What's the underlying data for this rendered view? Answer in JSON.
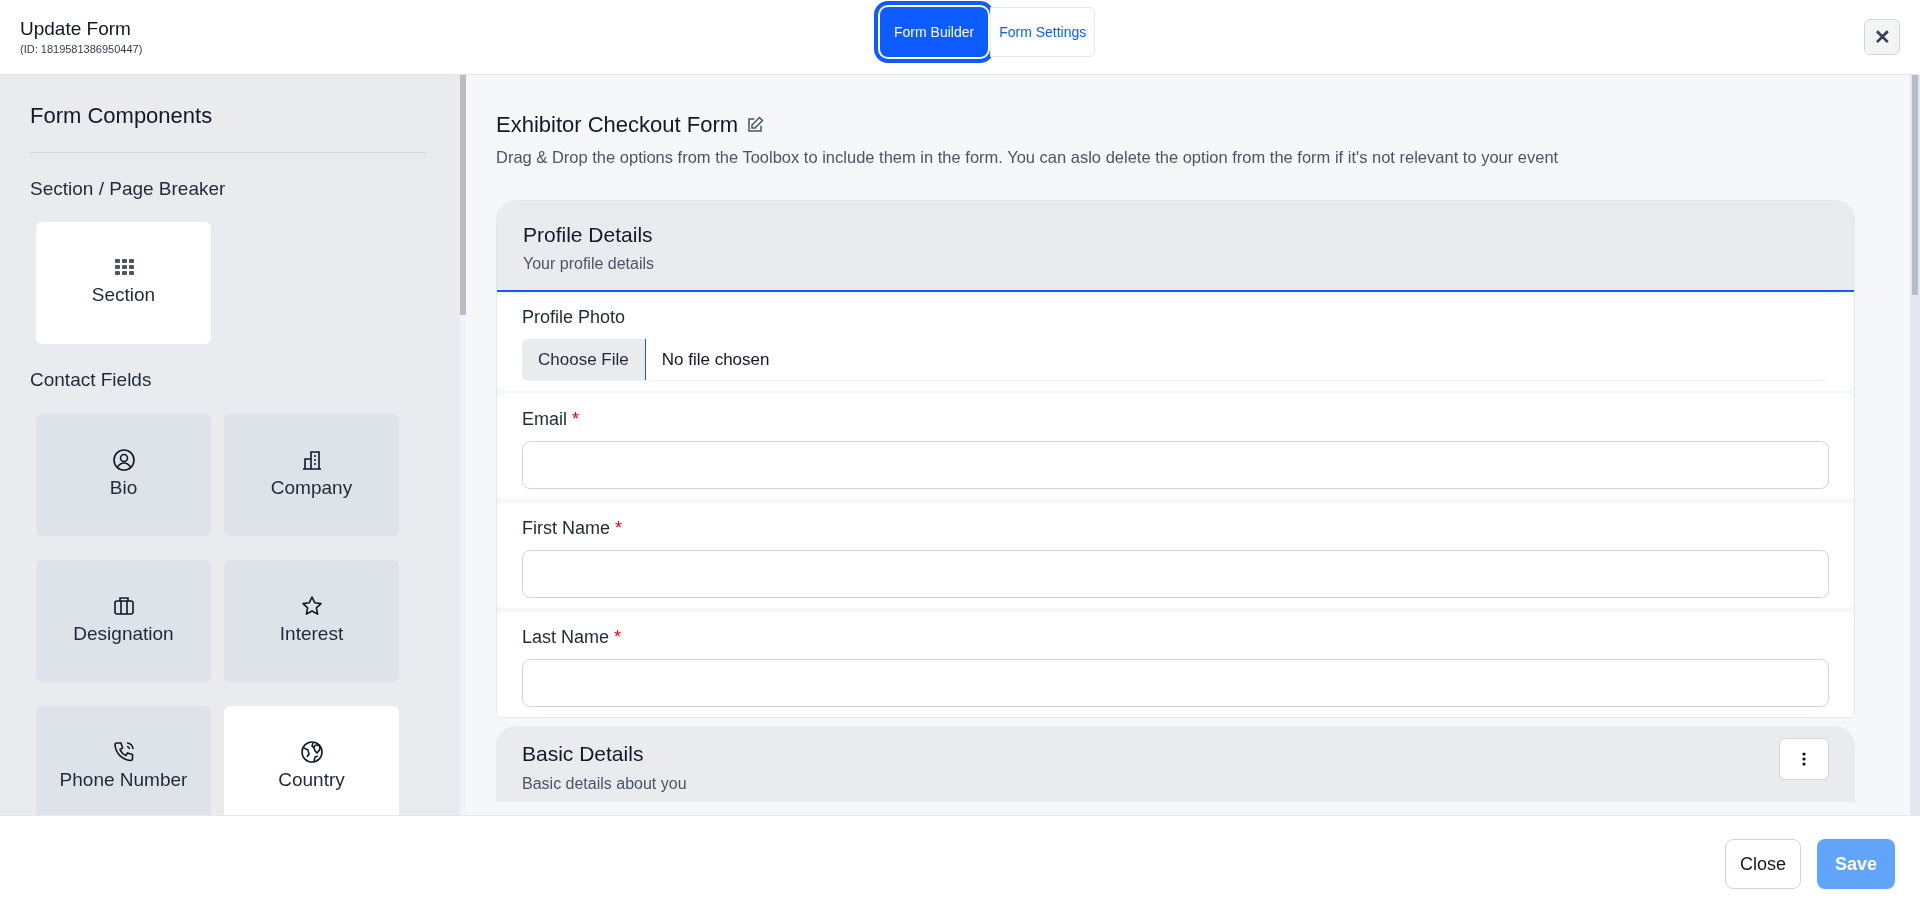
{
  "header": {
    "title": "Update Form",
    "subtitle": "(ID: 1819581386950447)",
    "tabs": [
      {
        "label": "Form Builder",
        "selected": true
      },
      {
        "label": "Form Settings",
        "selected": false
      }
    ],
    "close_icon": "✕"
  },
  "sidebar": {
    "title": "Form Components",
    "groups": [
      {
        "label": "Section / Page Breaker",
        "items": [
          {
            "label": "Section",
            "highlighted": true
          }
        ]
      },
      {
        "label": "Contact Fields",
        "items": [
          {
            "label": "Bio",
            "highlighted": false
          },
          {
            "label": "Company",
            "highlighted": false
          },
          {
            "label": "Designation",
            "highlighted": false
          },
          {
            "label": "Interest",
            "highlighted": false
          },
          {
            "label": "Phone Number",
            "highlighted": false
          },
          {
            "label": "Country",
            "highlighted": true
          }
        ]
      }
    ]
  },
  "form": {
    "title": "Exhibitor Checkout Form",
    "description": "Drag & Drop the options from the Toolbox to include them in the form. You can aslo delete the option from the form if it's not relevant to your event",
    "sections": [
      {
        "title": "Profile Details",
        "subtitle": "Your profile details",
        "active": true,
        "menu": false,
        "fields": [
          {
            "kind": "file",
            "label": "Profile Photo",
            "button": "Choose File",
            "value": "No file chosen"
          },
          {
            "kind": "text",
            "label": "Email",
            "marker": "*"
          },
          {
            "kind": "text",
            "label": "First Name",
            "marker": "*"
          },
          {
            "kind": "text",
            "label": "Last Name",
            "marker": "*"
          }
        ]
      },
      {
        "title": "Basic Details",
        "subtitle": "Basic details about you",
        "active": false,
        "menu": true
      }
    ]
  },
  "footer": {
    "buttons": [
      {
        "label": "Close",
        "kind": "secondary"
      },
      {
        "label": "Save",
        "kind": "primary"
      }
    ]
  }
}
